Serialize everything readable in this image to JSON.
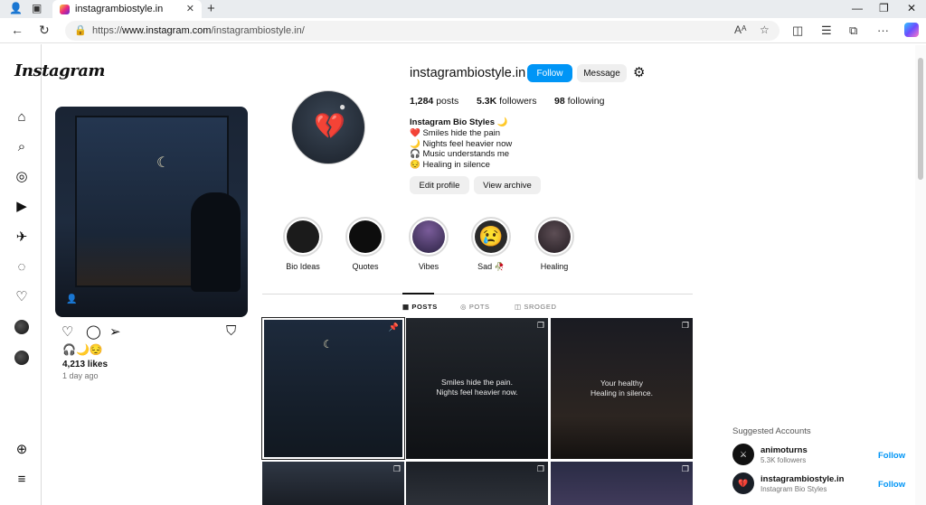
{
  "browser": {
    "tab_title": "instagrambiostyle.in",
    "url_prefix": "https://",
    "url_host": "www.instagram.com",
    "url_path": "/instagrambiostyle.in/",
    "new_tab": "+",
    "tab_close": "✕"
  },
  "sidebar": {
    "logo": "Instagram",
    "items": [
      "home-icon",
      "search-icon",
      "explore-icon",
      "reels-icon",
      "messages-icon",
      "threads-icon",
      "notifications-icon"
    ]
  },
  "post": {
    "emojis": "🎧🌙😔",
    "likes": "4,213 likes",
    "time": "1 day ago"
  },
  "profile": {
    "username": "instagrambiostyle.in",
    "follow_label": "Follow",
    "message_label": "Message",
    "posts_count": "1,284",
    "posts_label": "posts",
    "followers_count": "5.3K",
    "followers_label": "followers",
    "following_count": "98",
    "following_label": "following",
    "bio_title": "Instagram Bio Styles 🌙",
    "bio_lines": [
      "❤️ Smiles hide the pain",
      "🌙 Nights feel heavier now",
      "🎧 Music understands me",
      "😔 Healing in silence"
    ],
    "edit_profile": "Edit profile",
    "view_archive": "View archive"
  },
  "highlights": [
    {
      "label": "Bio Ideas",
      "color": "#1b1b1b"
    },
    {
      "label": "Quotes",
      "color": "#0d0d0d"
    },
    {
      "label": "Vibes",
      "color": "#4b3a6a"
    },
    {
      "label": "Sad 🥀",
      "color": "#2a2a2a"
    },
    {
      "label": "Healing",
      "color": "#3b3236"
    }
  ],
  "grid_tabs": {
    "posts": "POSTS",
    "pots": "POTS",
    "sroged": "SROGED"
  },
  "grid": {
    "cap2": [
      "Smiles hide the pain.",
      "Nights feel heavier now."
    ],
    "cap3": [
      "Your healthy",
      "Healing in silence."
    ]
  },
  "suggested": {
    "heading": "Suggested Accounts",
    "accounts": [
      {
        "name": "animoturns",
        "sub": "5.3K followers",
        "action": "Follow"
      },
      {
        "name": "instagrambiostyle.in",
        "sub": "Instagram Bio Styles",
        "action": "Follow"
      }
    ]
  },
  "colors": {
    "accent": "#0095f6",
    "button_bg": "#efefef"
  }
}
